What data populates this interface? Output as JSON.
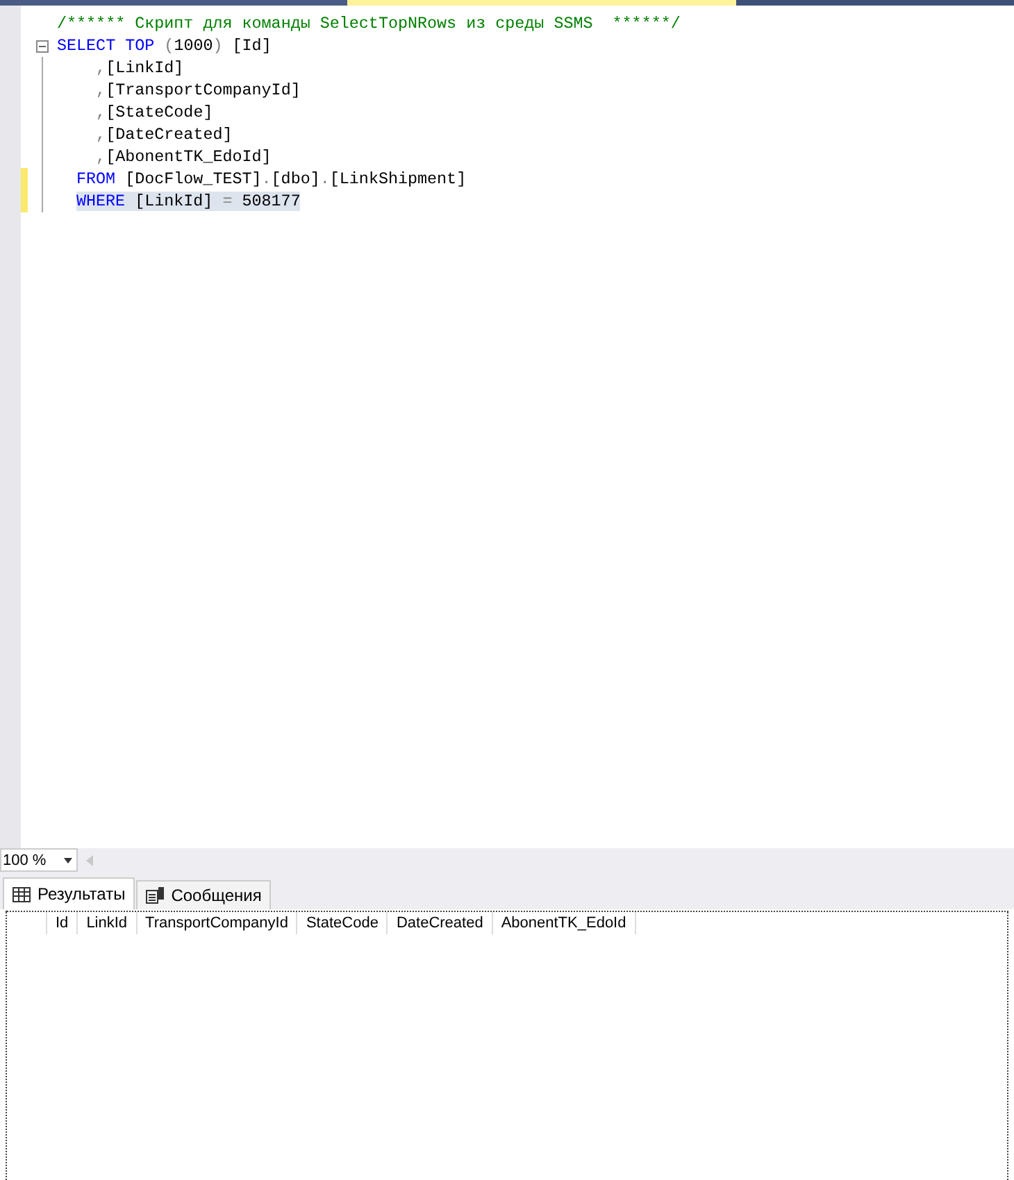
{
  "editor": {
    "lines": [
      {
        "fold": false,
        "changed": false,
        "selected": false,
        "tokens": [
          {
            "kind": "comment",
            "text": "/****** Скрипт для команды SelectTopNRows из среды SSMS  ******/"
          }
        ]
      },
      {
        "fold": true,
        "changed": false,
        "selected": false,
        "tokens": [
          {
            "kind": "keyword",
            "text": "SELECT "
          },
          {
            "kind": "keyword",
            "text": "TOP"
          },
          {
            "kind": "punct",
            "text": " ("
          },
          {
            "kind": "plain",
            "text": "1000"
          },
          {
            "kind": "punct",
            "text": ")"
          },
          {
            "kind": "plain",
            "text": " [Id]"
          }
        ]
      },
      {
        "fold": false,
        "changed": false,
        "selected": false,
        "tokens": [
          {
            "kind": "punct",
            "text": "    ,"
          },
          {
            "kind": "plain",
            "text": "[LinkId]"
          }
        ]
      },
      {
        "fold": false,
        "changed": false,
        "selected": false,
        "tokens": [
          {
            "kind": "punct",
            "text": "    ,"
          },
          {
            "kind": "plain",
            "text": "[TransportCompanyId]"
          }
        ]
      },
      {
        "fold": false,
        "changed": false,
        "selected": false,
        "tokens": [
          {
            "kind": "punct",
            "text": "    ,"
          },
          {
            "kind": "plain",
            "text": "[StateCode]"
          }
        ]
      },
      {
        "fold": false,
        "changed": false,
        "selected": false,
        "tokens": [
          {
            "kind": "punct",
            "text": "    ,"
          },
          {
            "kind": "plain",
            "text": "[DateCreated]"
          }
        ]
      },
      {
        "fold": false,
        "changed": false,
        "selected": false,
        "tokens": [
          {
            "kind": "punct",
            "text": "    ,"
          },
          {
            "kind": "plain",
            "text": "[AbonentTK_EdoId]"
          }
        ]
      },
      {
        "fold": false,
        "changed": true,
        "selected": false,
        "indented": true,
        "tokens": [
          {
            "kind": "keyword",
            "text": "FROM"
          },
          {
            "kind": "plain",
            "text": " [DocFlow_TEST]"
          },
          {
            "kind": "punct",
            "text": "."
          },
          {
            "kind": "plain",
            "text": "[dbo]"
          },
          {
            "kind": "punct",
            "text": "."
          },
          {
            "kind": "plain",
            "text": "[LinkShipment]"
          }
        ]
      },
      {
        "fold": false,
        "changed": true,
        "selected": true,
        "indented": true,
        "tokens": [
          {
            "kind": "keyword",
            "text": "WHERE"
          },
          {
            "kind": "plain",
            "text": " [LinkId] "
          },
          {
            "kind": "punct",
            "text": "="
          },
          {
            "kind": "plain",
            "text": " 508177"
          }
        ]
      }
    ]
  },
  "zoom": {
    "value": "100 %"
  },
  "result_tabs": [
    {
      "label": "Результаты",
      "kind": "grid",
      "selected": true
    },
    {
      "label": "Сообщения",
      "kind": "messages",
      "selected": false
    }
  ],
  "results": {
    "columns": [
      "Id",
      "LinkId",
      "TransportCompanyId",
      "StateCode",
      "DateCreated",
      "AbonentTK_EdoId"
    ]
  }
}
